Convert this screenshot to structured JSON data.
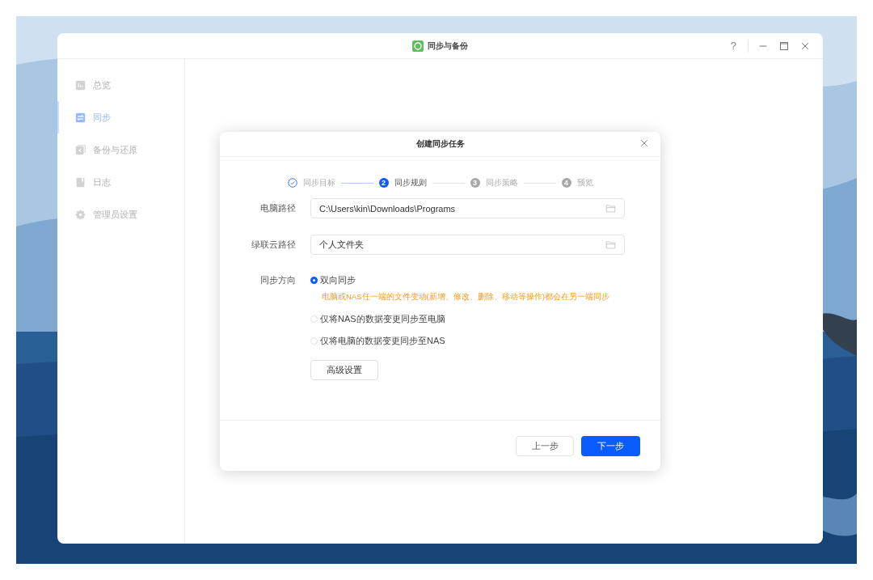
{
  "window": {
    "title": "同步与备份",
    "controls": [
      "?"
    ]
  },
  "sidebar": {
    "items": [
      {
        "label": "总览",
        "selected": false
      },
      {
        "label": "同步",
        "selected": true
      },
      {
        "label": "备份与还原",
        "selected": false
      },
      {
        "label": "日志",
        "selected": false
      },
      {
        "label": "管理员设置",
        "selected": false
      }
    ]
  },
  "dialog": {
    "title": "创建同步任务",
    "steps": [
      {
        "label": "同步目标",
        "done": true,
        "selected": false
      },
      {
        "number": "2",
        "label": "同步规则",
        "done": false,
        "selected": true
      },
      {
        "number": "3",
        "label": "同步策略",
        "done": false,
        "selected": false
      },
      {
        "number": "4",
        "label": "预览",
        "done": false,
        "selected": false
      }
    ],
    "fields": [
      {
        "label": "电脑路径",
        "value": "C:\\Users\\kin\\Downloads\\Programs"
      },
      {
        "label": "绿联云路径",
        "value": "个人文件夹"
      }
    ],
    "direction": {
      "label": "同步方向",
      "options": [
        {
          "label": "双向同步",
          "selected": true,
          "note": "电脑或NAS任一端的文件变动(新增、修改、删除、移动等操作)都会在另一端同步"
        },
        {
          "label": "仅将NAS的数据变更同步至电脑",
          "selected": false
        },
        {
          "label": "仅将电脑的数据变更同步至NAS",
          "selected": false
        }
      ]
    },
    "advanced_button": "高级设置",
    "buttons": [
      {
        "label": "上一步",
        "kind": "secondary"
      },
      {
        "label": "下一步",
        "kind": "primary"
      }
    ]
  }
}
